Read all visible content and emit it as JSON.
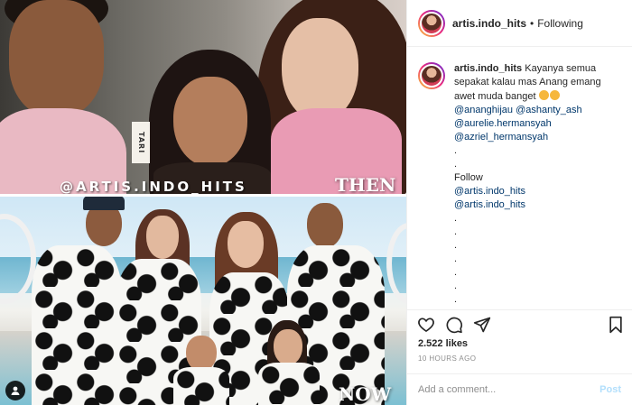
{
  "photo": {
    "watermark": "@ARTIS.INDO_HITS",
    "then_label": "THEN",
    "now_label": "NOW",
    "sign_text": "TARI",
    "icons": {
      "tag": "user-tag-icon"
    }
  },
  "header": {
    "username": "artis.indo_hits",
    "separator": "•",
    "follow_label": "Following"
  },
  "caption": {
    "username": "artis.indo_hits",
    "text_line1": "Kayanya semua sepakat kalau mas Anang emang awet muda banget",
    "mention_inline": "@ananghijau",
    "mentions": [
      "@ashanty_ash",
      "@aurelie.hermansyah",
      "@azriel_hermansyah"
    ],
    "separator_dots_top": [
      ".",
      "."
    ],
    "follow_label": "Follow",
    "follow_mentions": [
      "@artis.indo_hits",
      "@artis.indo_hits"
    ],
    "separator_dots_bottom": [
      ".",
      ".",
      ".",
      ".",
      ".",
      ".",
      ".",
      ".",
      "."
    ]
  },
  "actions": {
    "icons": [
      "heart-icon",
      "comment-icon",
      "share-icon",
      "bookmark-icon"
    ]
  },
  "likes": "2.522 likes",
  "timestamp": "10 HOURS AGO",
  "comment": {
    "placeholder": "Add a comment...",
    "post_label": "Post"
  },
  "colors": {
    "text": "#262626",
    "muted": "#8e8e8e",
    "link": "#00376b",
    "post_disabled": "#b2dffc",
    "border": "#efefef"
  }
}
